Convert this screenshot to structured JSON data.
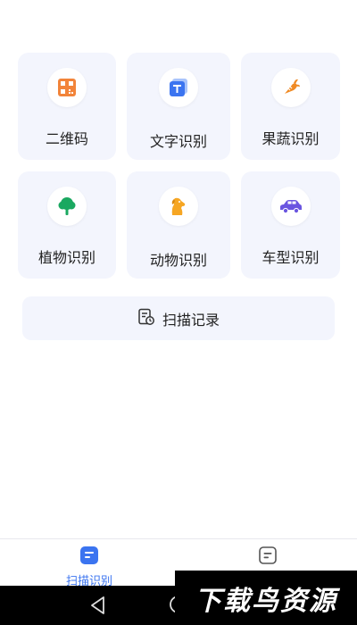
{
  "tiles": [
    {
      "label": "二维码",
      "icon": "qrcode-icon"
    },
    {
      "label": "文字识别",
      "icon": "text-recognition-icon"
    },
    {
      "label": "果蔬识别",
      "icon": "carrot-icon"
    },
    {
      "label": "植物识别",
      "icon": "tree-icon"
    },
    {
      "label": "动物识别",
      "icon": "dog-icon"
    },
    {
      "label": "车型识别",
      "icon": "car-icon"
    }
  ],
  "history": {
    "label": "扫描记录",
    "icon": "scan-record-icon"
  },
  "tabbar": {
    "tabs": [
      {
        "label": "扫描识别",
        "icon": "scan-tab-icon",
        "active": true
      },
      {
        "label": "",
        "icon": "list-tab-icon",
        "active": false
      }
    ]
  },
  "navbar": {
    "back_icon": "back-triangle-icon",
    "home_icon": "home-circle-icon"
  },
  "watermark": {
    "text": "下载鸟资源"
  },
  "colors": {
    "tile_bg": "#f3f5fd",
    "accent": "#3b74f0",
    "carrot": "#f08a24",
    "tree": "#1aa860",
    "dog": "#f6a623",
    "car": "#6a55e0",
    "qr_orange": "#f2843a"
  }
}
